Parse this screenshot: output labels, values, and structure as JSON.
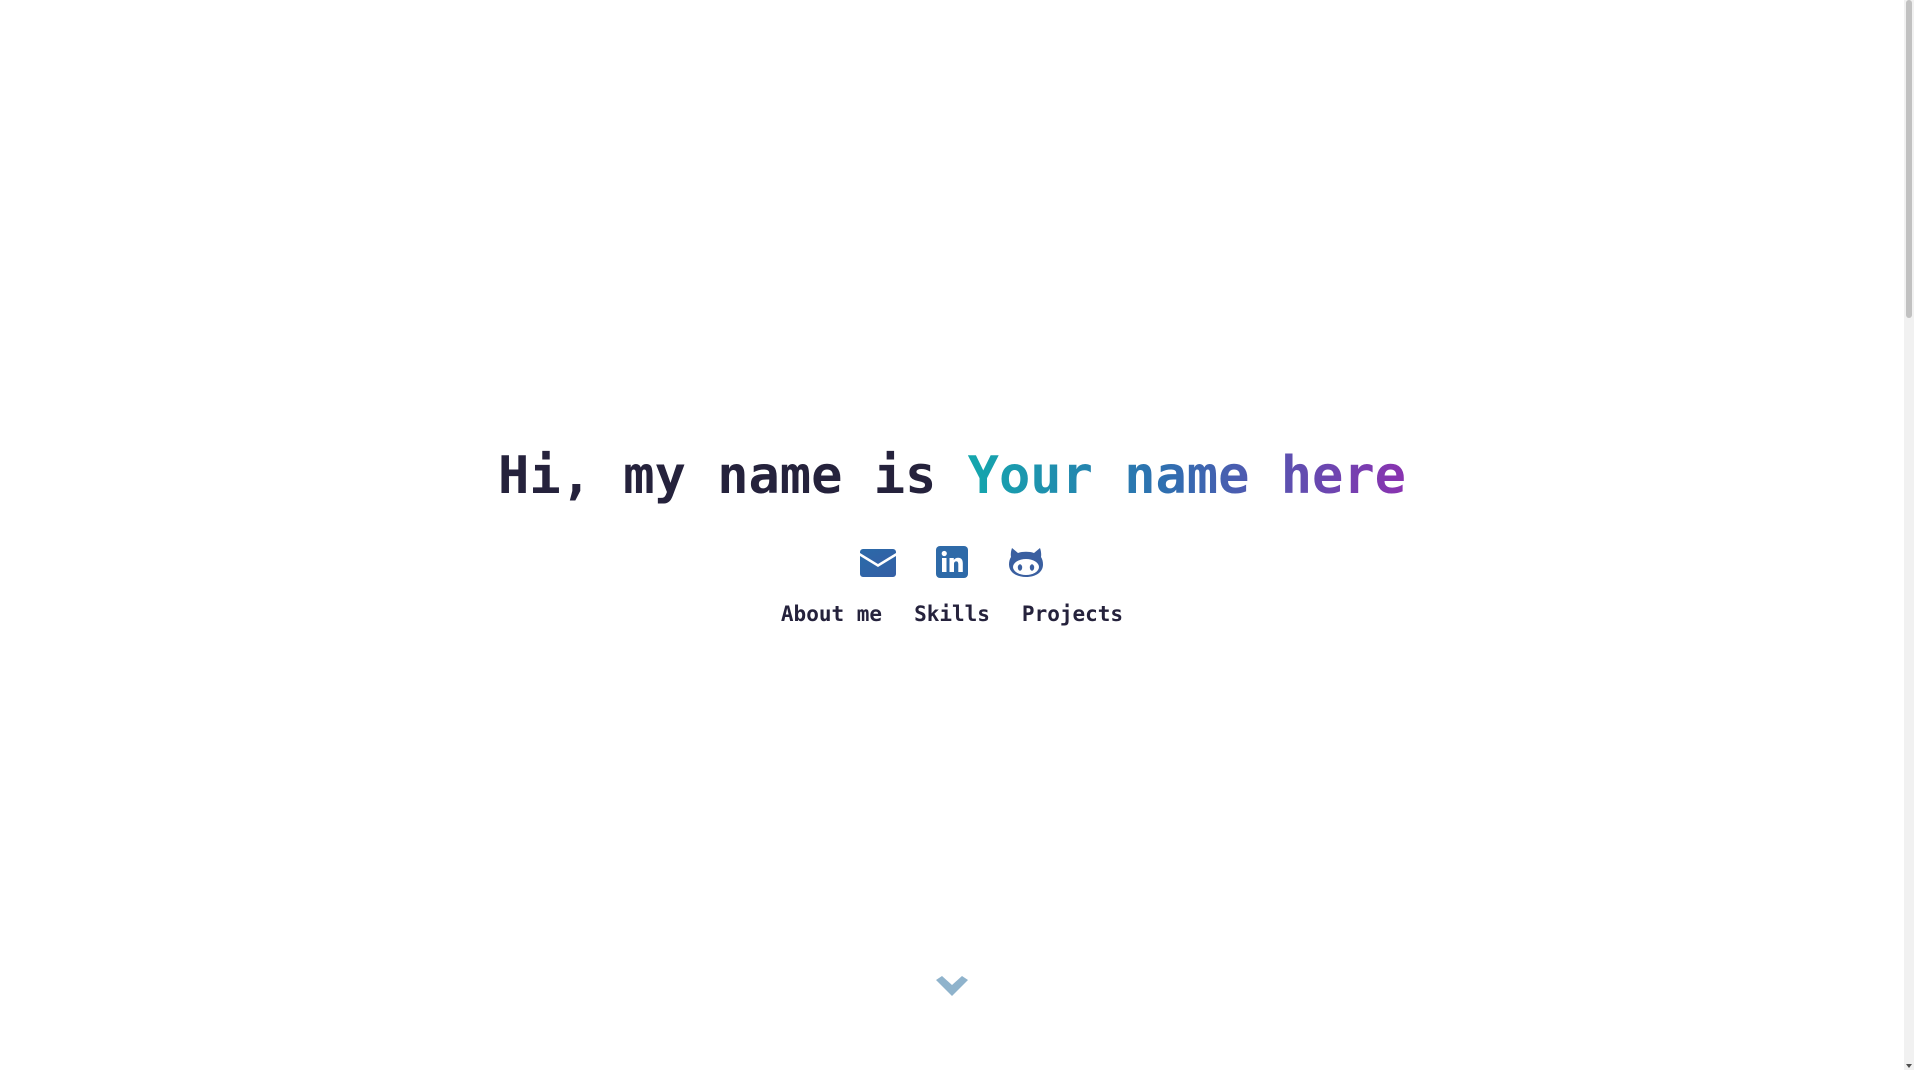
{
  "hero": {
    "greeting": "Hi, my name is",
    "name": "Your name here"
  },
  "social": [
    {
      "icon": "envelope-icon",
      "label": "Email"
    },
    {
      "icon": "linkedin-icon",
      "label": "LinkedIn"
    },
    {
      "icon": "github-icon",
      "label": "GitHub"
    }
  ],
  "nav": {
    "about": "About me",
    "skills": "Skills",
    "projects": "Projects"
  },
  "colors": {
    "text": "#25223c",
    "accent_start": "#14a7ad",
    "accent_mid": "#2f6fb0",
    "accent_end": "#8a32b0",
    "scroll_arrow": "#8fb3cc"
  }
}
